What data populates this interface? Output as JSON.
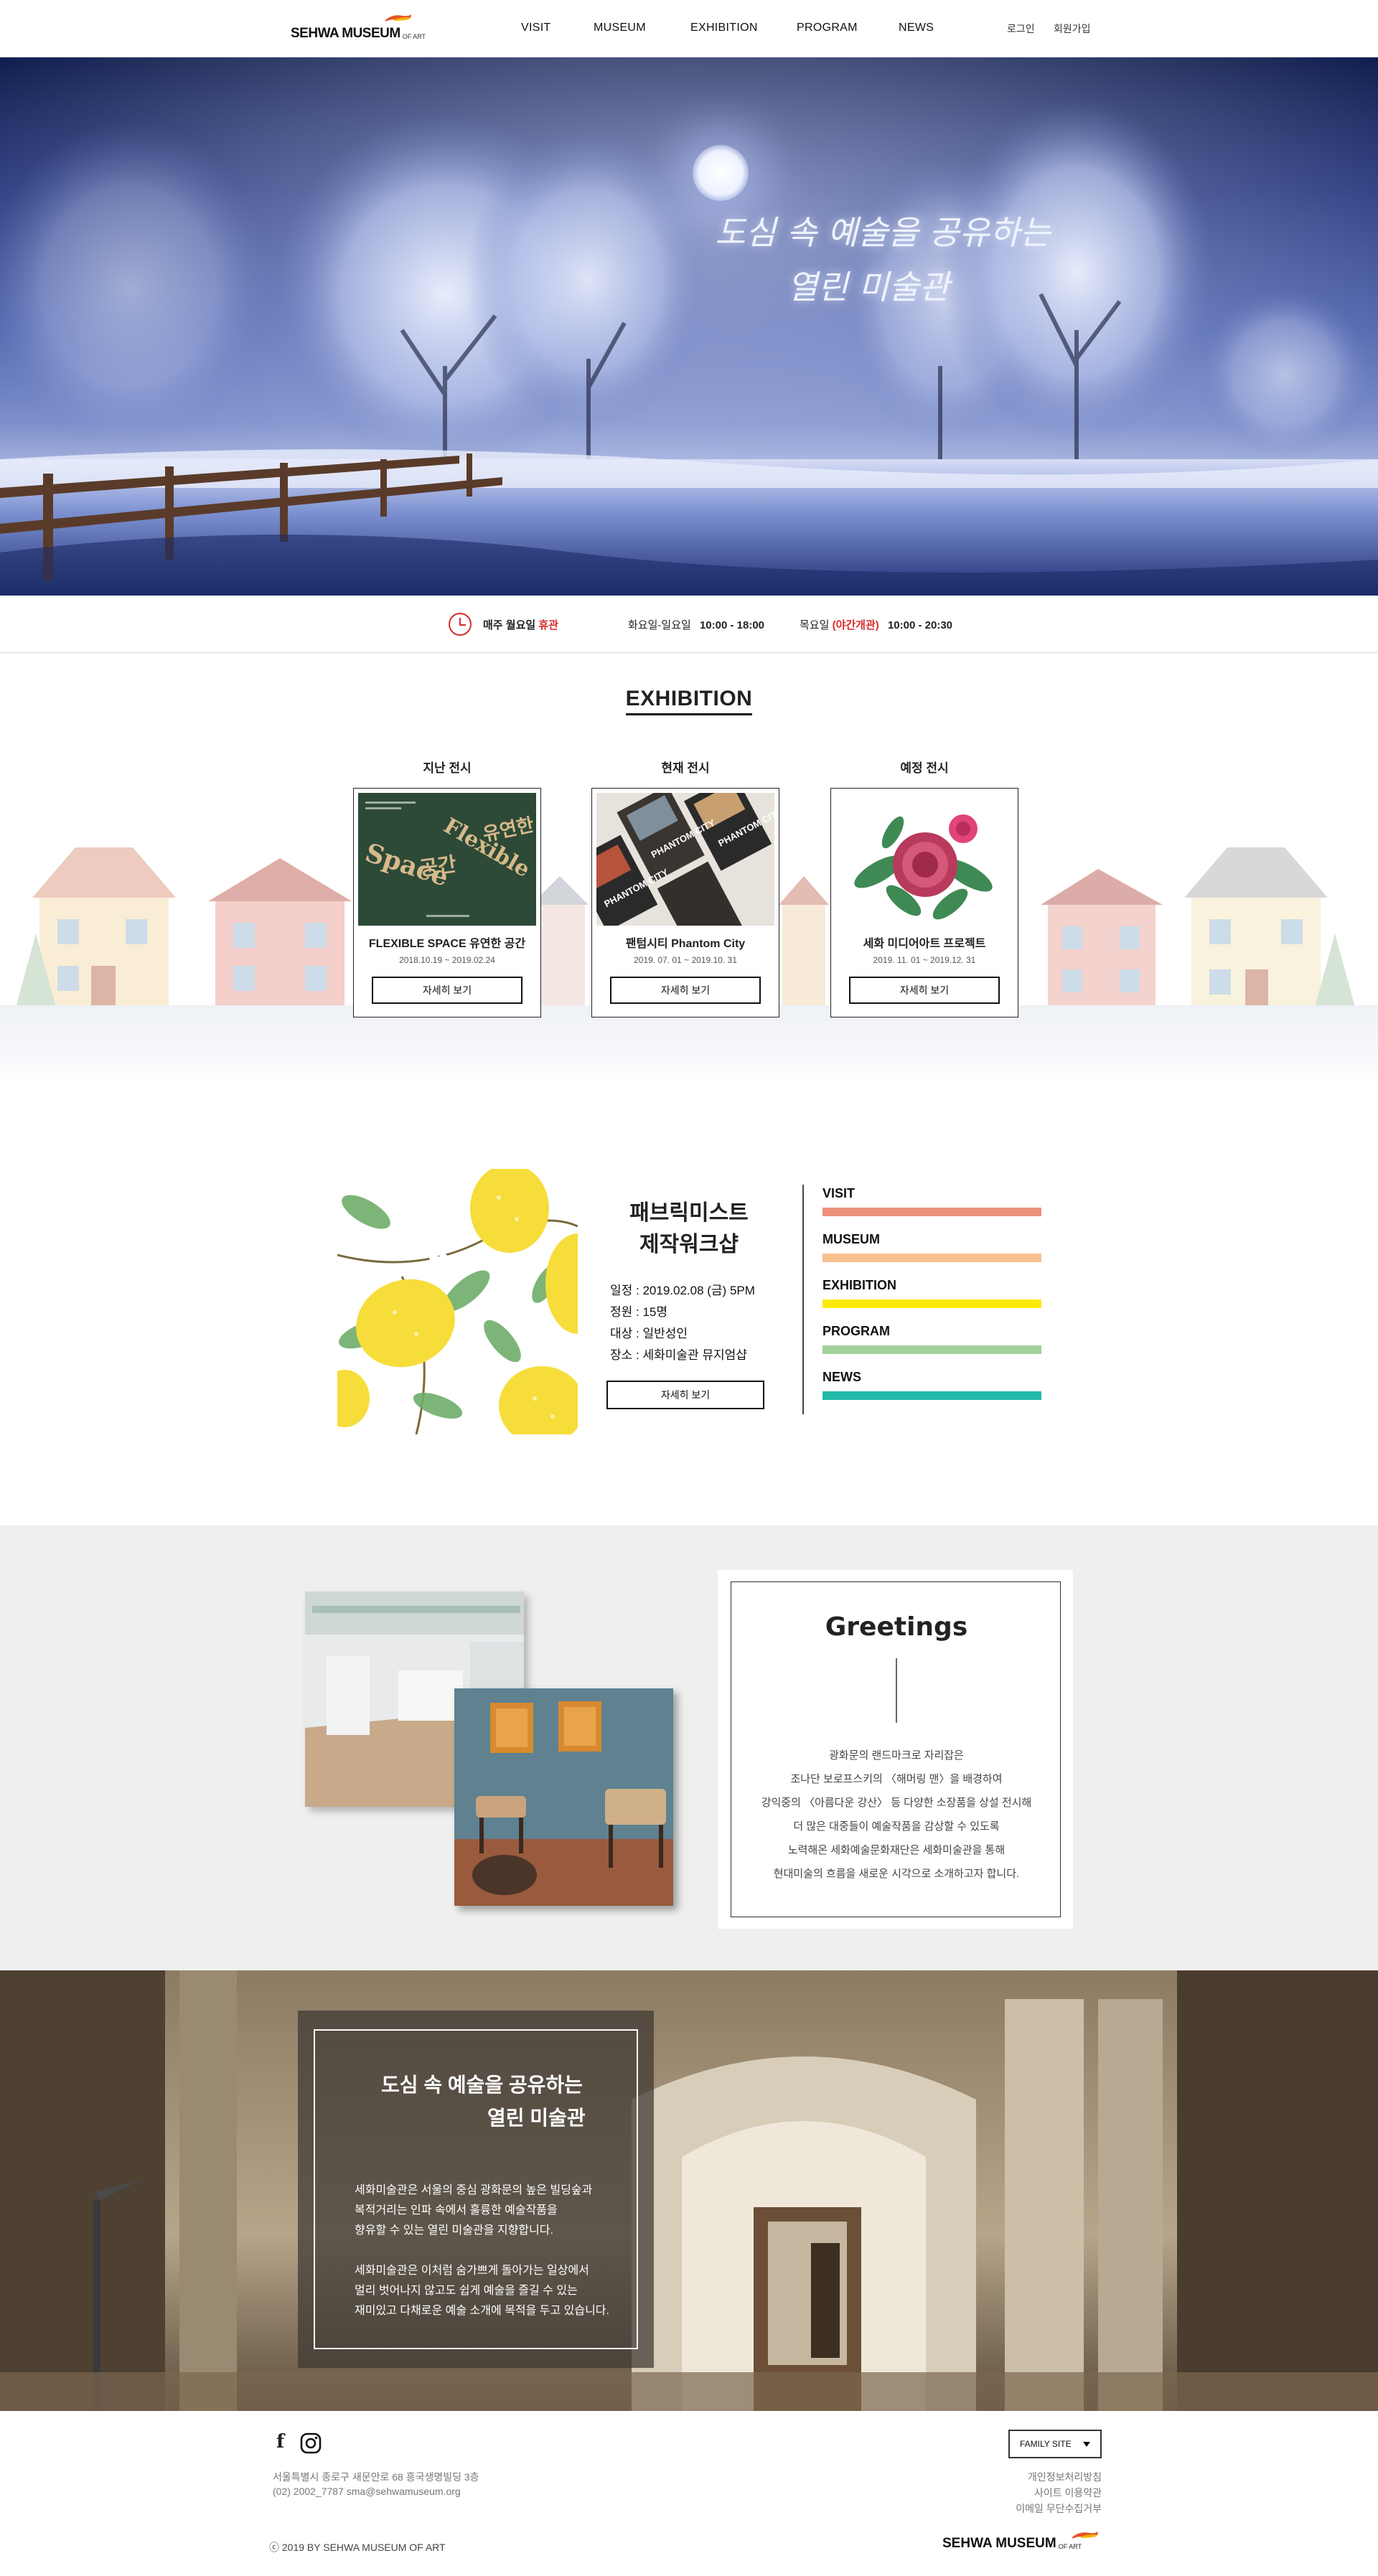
{
  "header": {
    "logo_main": "SEHWA MUSEUM",
    "logo_sub": "OF ART",
    "nav": [
      "VISIT",
      "MUSEUM",
      "EXHIBITION",
      "PROGRAM",
      "NEWS"
    ],
    "login": "로그인",
    "signup": "회원가입"
  },
  "hero": {
    "line1": "도심 속 예술을 공유하는",
    "line2": "열린 미술관"
  },
  "hours": {
    "closed_prefix": "매주 월요일",
    "closed_word": "휴관",
    "weekday_label": "화요일-일요일",
    "weekday_time": "10:00 - 18:00",
    "thursday_label": "목요일",
    "night_open": "(야간개관)",
    "thursday_time": "10:00 - 20:30"
  },
  "exhibition": {
    "title": "EXHIBITION",
    "cards": [
      {
        "label": "지난 전시",
        "title": "FLEXIBLE SPACE 유연한 공간",
        "date": "2018.10.19  ~  2019.02.24",
        "button": "자세히 보기"
      },
      {
        "label": "현재 전시",
        "title": "팬텀시티 Phantom City",
        "date": "2019. 07. 01  ~  2019.10. 31",
        "button": "자세히 보기"
      },
      {
        "label": "예정 전시",
        "title": "세화 미디어아트 프로젝트",
        "date": "2019. 11. 01  ~  2019.12. 31",
        "button": "자세히 보기"
      }
    ],
    "poster1": {
      "line1": "Space",
      "line2": "공간",
      "line3": "Flexible",
      "line4": "유연한"
    },
    "poster2": {
      "text": "PHANTOM CITY"
    }
  },
  "program": {
    "title_line1": "패브릭미스트",
    "title_line2": "제작워크샵",
    "info": [
      "일정 : 2019.02.08 (금) 5PM",
      "정원 : 15명",
      "대상 : 일반성인",
      "장소 : 세화미술관 뮤지엄샵"
    ],
    "button": "자세히 보기",
    "menu": [
      {
        "label": "VISIT",
        "color": "#ec927a"
      },
      {
        "label": "MUSEUM",
        "color": "#f8c18e"
      },
      {
        "label": "EXHIBITION",
        "color": "#faea0a"
      },
      {
        "label": "PROGRAM",
        "color": "#a2d199"
      },
      {
        "label": "NEWS",
        "color": "#23b9a8"
      }
    ]
  },
  "greetings": {
    "title": "Greetings",
    "lines": [
      "광화문의 랜드마크로 자리잡은",
      "조나단 보로프스키의 〈해머링 맨〉을 배경하여",
      "강익중의 〈아름다운 강산〉 등 다양한 소장품을 상설 전시해",
      "더 많은 대중들이 예술작품을 감상할 수 있도록",
      "노력해온 세화예술문화재단은 세화미술관을 통해",
      "현대미술의 흐름을 새로운 시각으로 소개하고자 합니다."
    ]
  },
  "banner": {
    "title_line1": "도심 속 예술을 공유하는",
    "title_line2": "열린 미술관",
    "para1": [
      "세화미술관은 서울의 중심 광화문의 높은 빌딩숲과",
      "복적거리는 인파 속에서 훌륭한 예술작품을",
      "향유할 수 있는 열린 미술관을 지향합니다."
    ],
    "para2": [
      "세화미술관은 이처럼 숨가쁘게 돌아가는 일상에서",
      "멀리 벗어나지 않고도 쉽게 예술을 즐길 수 있는",
      "재미있고 다채로운 예술 소개에 목적을 두고 있습니다."
    ]
  },
  "footer": {
    "address": "서울특별시 종로구 새문안로 68 흥국생명빌딩 3층",
    "contact": "(02) 2002_7787  sma@sehwamuseum.org",
    "copyright": "ⓒ 2019 BY SEHWA MUSEUM OF ART",
    "family_site": "FAMILY SITE",
    "links": [
      "개인정보처리방침",
      "사이트 이용약관",
      "이메일 무단수집거부"
    ],
    "logo_main": "SEHWA MUSEUM",
    "logo_sub": "OF ART",
    "facebook": "f"
  }
}
